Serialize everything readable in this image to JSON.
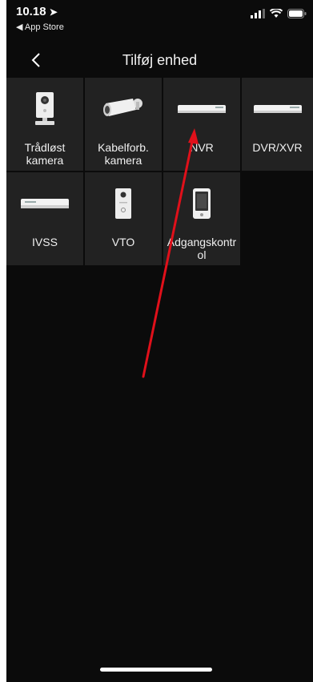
{
  "status_bar": {
    "time": "10.18",
    "back_app": "◀ App Store"
  },
  "nav": {
    "title": "Tilføj enhed"
  },
  "devices": [
    {
      "label": "Trådløst kamera",
      "icon": "wireless-camera-icon"
    },
    {
      "label": "Kabelforb. kamera",
      "icon": "bullet-camera-icon"
    },
    {
      "label": "NVR",
      "icon": "nvr-icon"
    },
    {
      "label": "DVR/XVR",
      "icon": "dvr-icon"
    },
    {
      "label": "IVSS",
      "icon": "ivss-icon"
    },
    {
      "label": "VTO",
      "icon": "vto-icon"
    },
    {
      "label": "Adgangskontrol",
      "icon": "access-control-icon"
    }
  ],
  "colors": {
    "background": "#0b0b0b",
    "tile": "#222222",
    "annotation_arrow": "#e0101a"
  }
}
